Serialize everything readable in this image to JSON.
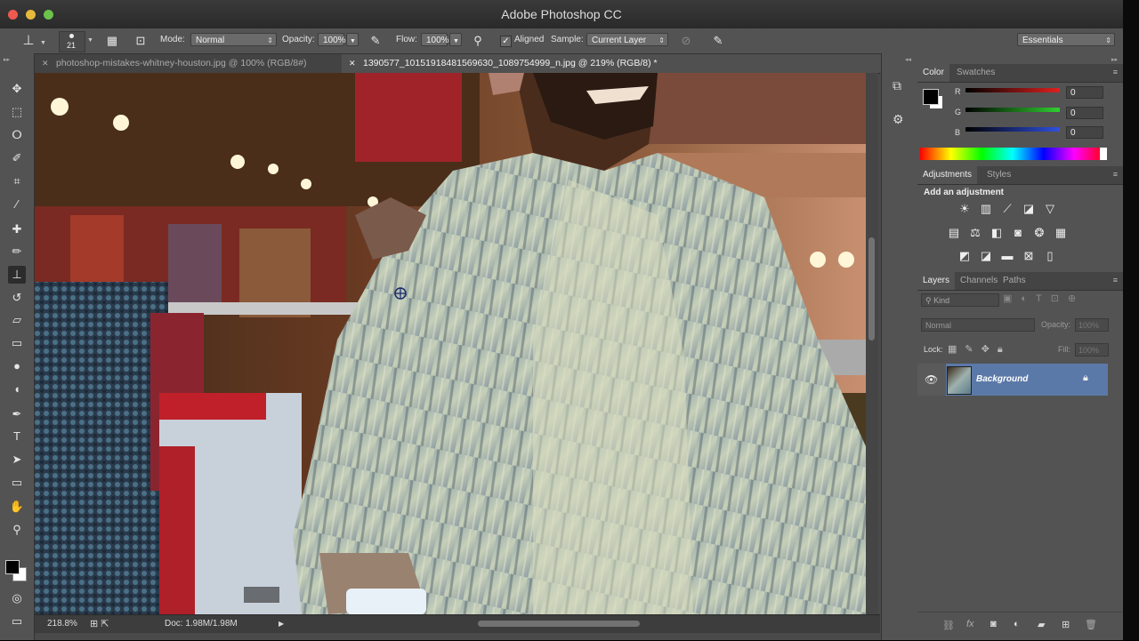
{
  "window": {
    "title": "Adobe Photoshop CC"
  },
  "options_bar": {
    "brush_size": "21",
    "mode_label": "Mode:",
    "mode_value": "Normal",
    "opacity_label": "Opacity:",
    "opacity_value": "100%",
    "flow_label": "Flow:",
    "flow_value": "100%",
    "aligned_label": "Aligned",
    "sample_label": "Sample:",
    "sample_value": "Current Layer",
    "workspace_value": "Essentials"
  },
  "tabs": [
    {
      "label": "photoshop-mistakes-whitney-houston.jpg @ 100% (RGB/8#)"
    },
    {
      "label": "1390577_10151918481569630_1089754999_n.jpg @ 219% (RGB/8) *"
    }
  ],
  "status": {
    "zoom": "218.8%",
    "doc": "Doc: 1.98M/1.98M"
  },
  "color_panel": {
    "tabs": [
      "Color",
      "Swatches"
    ],
    "channels": [
      {
        "label": "R",
        "value": "0",
        "color": "#d02020"
      },
      {
        "label": "G",
        "value": "0",
        "color": "#30c030"
      },
      {
        "label": "B",
        "value": "0",
        "color": "#3050e0"
      }
    ]
  },
  "adjustments_panel": {
    "tabs": [
      "Adjustments",
      "Styles"
    ],
    "heading": "Add an adjustment"
  },
  "layers_panel": {
    "tabs": [
      "Layers",
      "Channels",
      "Paths"
    ],
    "filter_kind": "Kind",
    "blend_mode": "Normal",
    "opacity_label": "Opacity:",
    "opacity_value": "100%",
    "lock_label": "Lock:",
    "fill_label": "Fill:",
    "fill_value": "100%",
    "layers": [
      {
        "name": "Background",
        "visible": true,
        "locked": true
      }
    ]
  },
  "tool_icons": [
    "move-icon",
    "marquee-icon",
    "lasso-icon",
    "quick-select-icon",
    "crop-icon",
    "eyedropper-icon",
    "healing-icon",
    "brush-icon",
    "clone-stamp-icon",
    "history-brush-icon",
    "eraser-icon",
    "gradient-icon",
    "blur-icon",
    "dodge-icon",
    "pen-icon",
    "type-icon",
    "path-select-icon",
    "shape-icon",
    "hand-icon",
    "zoom-icon"
  ]
}
